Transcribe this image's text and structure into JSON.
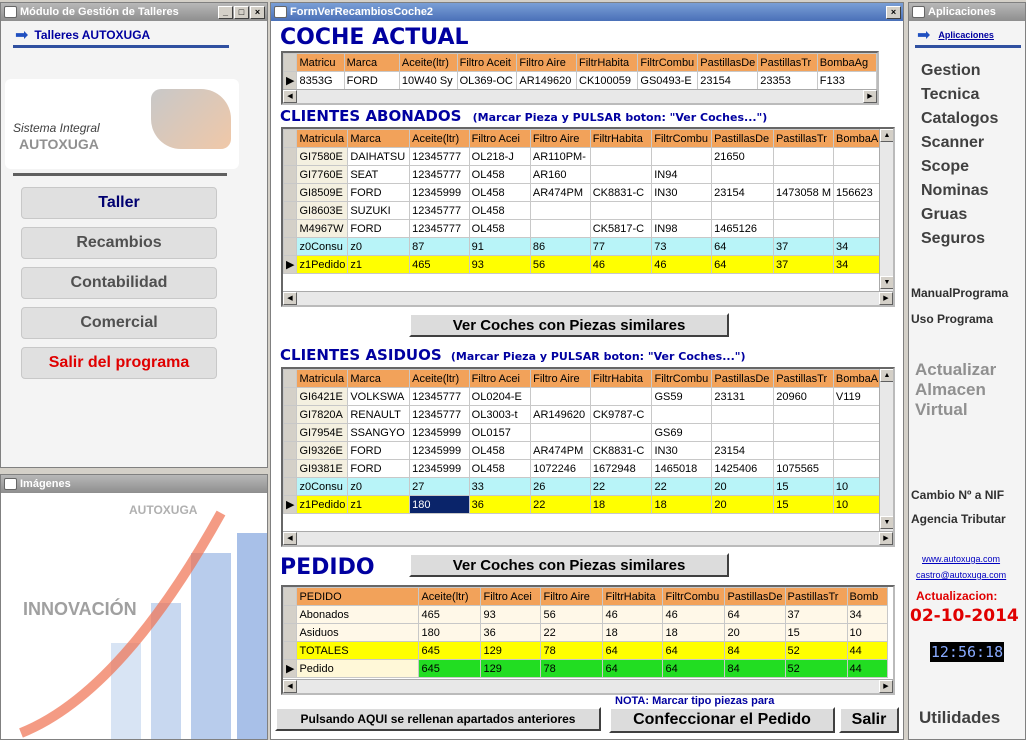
{
  "left_window": {
    "title": "Módulo de Gestión de Talleres",
    "header_label": "Talleres AUTOXUGA",
    "system_label": "Sistema Integral",
    "brand": "AUTOXUGA",
    "menu": [
      "Taller",
      "Recambios",
      "Contabilidad",
      "Comercial",
      "Salir del programa"
    ]
  },
  "images_window": {
    "title": "Imágenes",
    "brand": "AUTOXUGA",
    "caption": "INNOVACIÓN"
  },
  "main_window": {
    "title": "FormVerRecambiosCoche2",
    "coche_actual": {
      "heading": "COCHE ACTUAL",
      "columns": [
        "Matricu",
        "Marca",
        "Aceite(ltr)",
        "Filtro Aceit",
        "Filtro Aire",
        "FiltrHabita",
        "FiltrCombu",
        "PastillasDe",
        "PastillasTr",
        "BombaAg"
      ],
      "rows": [
        [
          "8353G",
          "FORD",
          "10W40 Sy",
          "OL369-OC",
          "AR149620",
          "CK100059",
          "GS0493-E",
          "23154",
          "23353",
          "F133"
        ]
      ]
    },
    "abonados": {
      "heading": "CLIENTES ABONADOS",
      "note": "(Marcar Pieza y PULSAR boton: \"Ver Coches...\")",
      "columns": [
        "Matricula",
        "Marca",
        "Aceite(ltr)",
        "Filtro Acei",
        "Filtro Aire",
        "FiltrHabita",
        "FiltrCombu",
        "PastillasDe",
        "PastillasTr",
        "BombaA"
      ],
      "rows": [
        [
          "GI7580E",
          "DAIHATSU",
          "12345777",
          "OL218-J",
          "AR110PM-",
          "",
          "",
          "21650",
          "",
          ""
        ],
        [
          "GI7760E",
          "SEAT",
          "12345777",
          "OL458",
          "AR160",
          "",
          "IN94",
          "",
          "",
          ""
        ],
        [
          "GI8509E",
          "FORD",
          "12345999",
          "OL458",
          "AR474PM",
          "CK8831-C",
          "IN30",
          "23154",
          "1473058 M",
          "156623"
        ],
        [
          "GI8603E",
          "SUZUKI",
          "12345777",
          "OL458",
          "",
          "",
          "",
          "",
          "",
          ""
        ],
        [
          "M4967W",
          "FORD",
          "12345777",
          "OL458",
          "",
          "CK5817-C",
          "IN98",
          "1465126",
          "",
          ""
        ],
        [
          "z0Consu",
          "z0",
          "87",
          "91",
          "86",
          "77",
          "73",
          "64",
          "37",
          "34"
        ],
        [
          "z1Pedido",
          "z1",
          "465",
          "93",
          "56",
          "46",
          "46",
          "64",
          "37",
          "34"
        ]
      ]
    },
    "button_ver_coches": "Ver Coches con Piezas similares",
    "asiduos": {
      "heading": "CLIENTES ASIDUOS",
      "note": "(Marcar Pieza y PULSAR boton: \"Ver Coches...\")",
      "columns": [
        "Matricula",
        "Marca",
        "Aceite(ltr)",
        "Filtro Acei",
        "Filtro Aire",
        "FiltrHabita",
        "FiltrCombu",
        "PastillasDe",
        "PastillasTr",
        "BombaA"
      ],
      "rows": [
        [
          "GI6421E",
          "VOLKSWA",
          "12345777",
          "OL0204-E",
          "",
          "",
          "GS59",
          "23131",
          "20960",
          "V119"
        ],
        [
          "GI7820A",
          "RENAULT",
          "12345777",
          "OL3003-t",
          "AR149620",
          "CK9787-C",
          "",
          "",
          "",
          ""
        ],
        [
          "GI7954E",
          "SSANGYO",
          "12345999",
          "OL0157",
          "",
          "",
          "GS69",
          "",
          "",
          ""
        ],
        [
          "GI9326E",
          "FORD",
          "12345999",
          "OL458",
          "AR474PM",
          "CK8831-C",
          "IN30",
          "23154",
          "",
          ""
        ],
        [
          "GI9381E",
          "FORD",
          "12345999",
          "OL458",
          "1072246",
          "1672948",
          "1465018",
          "1425406",
          "1075565",
          ""
        ],
        [
          "z0Consu",
          "z0",
          "27",
          "33",
          "26",
          "22",
          "22",
          "20",
          "15",
          "10"
        ],
        [
          "z1Pedido",
          "z1",
          "180",
          "36",
          "22",
          "18",
          "18",
          "20",
          "15",
          "10"
        ]
      ]
    },
    "pedido": {
      "heading": "PEDIDO",
      "columns": [
        "PEDIDO",
        "Aceite(ltr)",
        "Filtro Acei",
        "Filtro Aire",
        "FiltrHabita",
        "FiltrCombu",
        "PastillasDe",
        "PastillasTr",
        "Bomb"
      ],
      "rows": [
        [
          "Abonados",
          "465",
          "93",
          "56",
          "46",
          "46",
          "64",
          "37",
          "34"
        ],
        [
          "Asiduos",
          "180",
          "36",
          "22",
          "18",
          "18",
          "20",
          "15",
          "10"
        ],
        [
          "TOTALES",
          "645",
          "129",
          "78",
          "64",
          "64",
          "84",
          "52",
          "44"
        ],
        [
          "Pedido",
          "645",
          "129",
          "78",
          "64",
          "64",
          "84",
          "52",
          "44"
        ]
      ]
    },
    "button_rellenar": "Pulsando AQUI se rellenan apartados anteriores",
    "nota": "NOTA: Marcar tipo piezas para",
    "button_confeccionar": "Confeccionar el Pedido",
    "button_salir": "Salir"
  },
  "apps_window": {
    "title": "Aplicaciones",
    "header_label": "Aplicaciones",
    "items": [
      "Gestion",
      "Tecnica",
      "Catalogos",
      "Scanner",
      "Scope",
      "Nominas",
      "Gruas",
      "Seguros"
    ],
    "manual": "ManualPrograma",
    "uso": "Uso Programa",
    "actualizar": [
      "Actualizar",
      "Almacen",
      "Virtual"
    ],
    "cambio": "Cambio Nº a NIF",
    "agencia": "Agencia Tributar",
    "web": "www.autoxuga.com",
    "email": "castro@autoxuga.com",
    "actualizacion_label": "Actualizacion:",
    "actualizacion_date": "02-10-2014",
    "clock": "12:56:18",
    "utilidades": "Utilidades"
  }
}
